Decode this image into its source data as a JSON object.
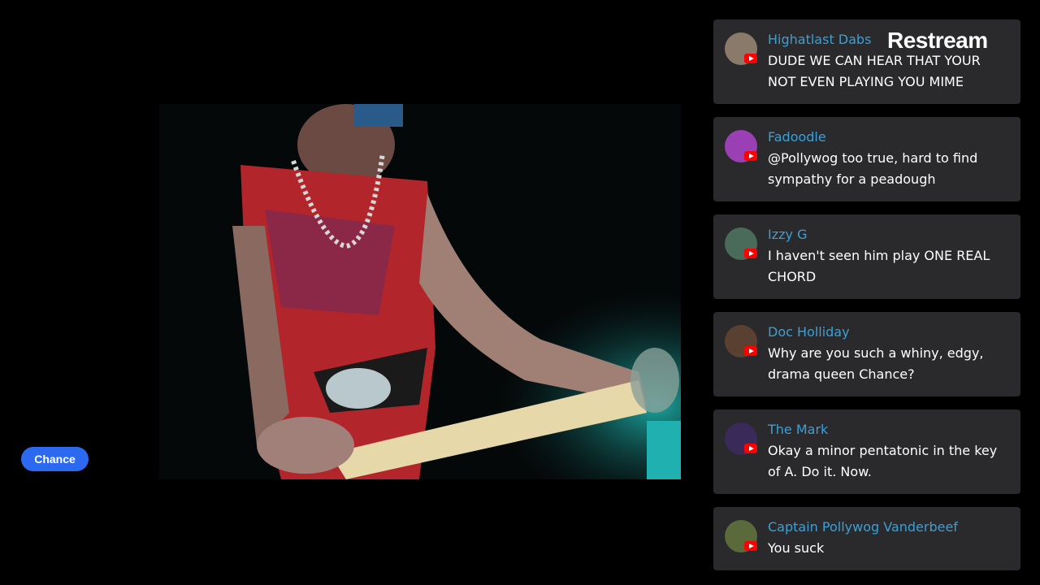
{
  "brand": {
    "name": "Restream"
  },
  "streamer": {
    "name": "Chance"
  },
  "chat": {
    "messages": [
      {
        "username": "Highatlast Dabs",
        "text": "DUDE WE CAN HEAR THAT YOUR NOT EVEN PLAYING YOU MIME",
        "platform_icon": "youtube-icon",
        "avatar_color": "#8a7a6a"
      },
      {
        "username": "Fadoodle",
        "text": "@Pollywog too true, hard to find sympathy for a peadough",
        "platform_icon": "youtube-icon",
        "avatar_color": "#9b3fb5"
      },
      {
        "username": "Izzy G",
        "text": "I haven't seen him play ONE REAL CHORD",
        "platform_icon": "youtube-icon",
        "avatar_color": "#4a6a5a"
      },
      {
        "username": "Doc Holliday",
        "text": "Why are you such a whiny, edgy, drama queen Chance?",
        "platform_icon": "youtube-icon",
        "avatar_color": "#5a4030"
      },
      {
        "username": "The Mark",
        "text": "Okay a minor pentatonic in the key of A. Do it. Now.",
        "platform_icon": "youtube-icon",
        "avatar_color": "#3a2a5a"
      },
      {
        "username": "Captain Pollywog Vanderbeef",
        "text": "You suck",
        "platform_icon": "youtube-icon",
        "avatar_color": "#5a6a3a"
      }
    ]
  }
}
